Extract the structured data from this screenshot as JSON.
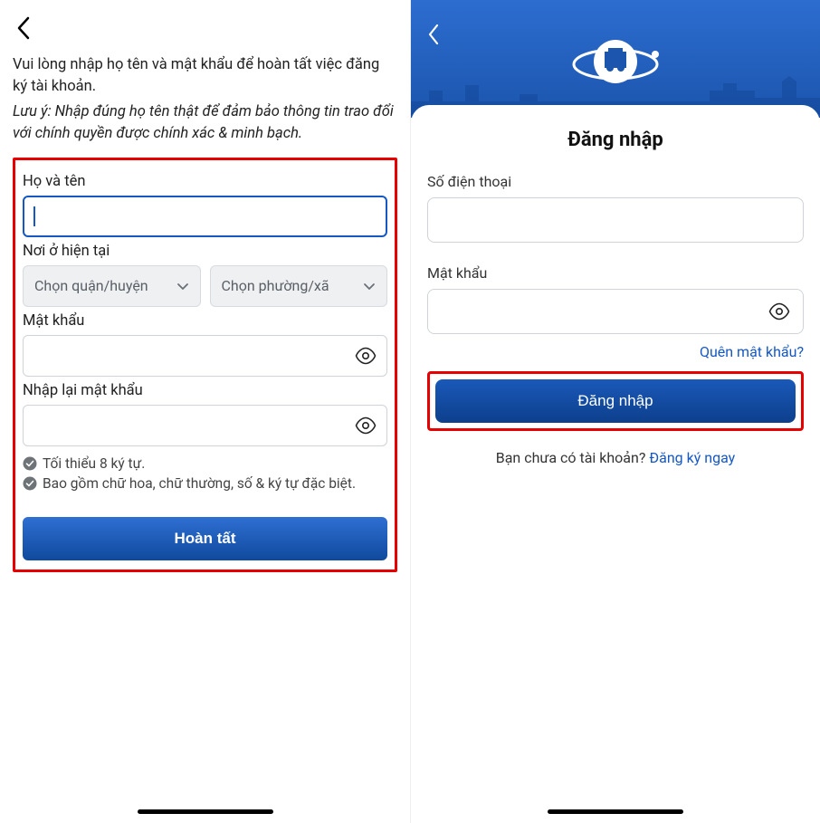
{
  "left": {
    "intro": "Vui lòng nhập họ tên và mật khẩu để hoàn tất việc đăng ký tài khoản.",
    "note": "Lưu ý: Nhập đúng họ tên thật để đảm bảo thông tin trao đổi với chính quyền được chính xác & minh bạch.",
    "fullname_label": "Họ và tên",
    "location_label": "Nơi ở hiện tại",
    "district_placeholder": "Chọn quận/huyện",
    "ward_placeholder": "Chọn phường/xã",
    "password_label": "Mật khẩu",
    "confirm_label": "Nhập lại mật khẩu",
    "hint1": "Tối thiểu 8 ký tự.",
    "hint2": "Bao gồm chữ hoa, chữ thường, số & ký tự đặc biệt.",
    "submit": "Hoàn tất"
  },
  "right": {
    "title": "Đăng nhập",
    "phone_label": "Số điện thoại",
    "password_label": "Mật khẩu",
    "forgot": "Quên mật khẩu?",
    "login_btn": "Đăng nhập",
    "no_account": "Bạn chưa có tài khoản? ",
    "signup_link": "Đăng ký ngay"
  }
}
